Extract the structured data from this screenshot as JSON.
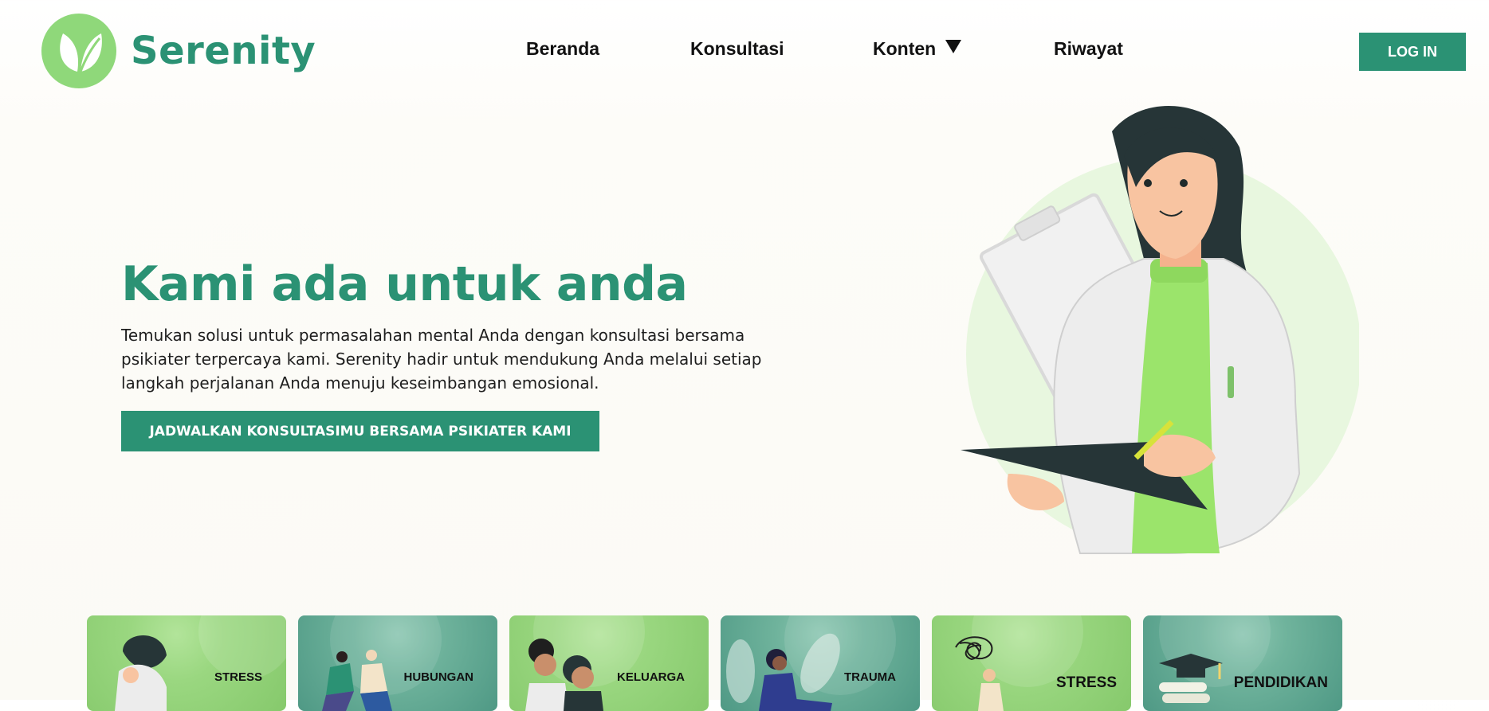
{
  "brand": {
    "name": "Serenity",
    "logo_icon": "leaf-icon"
  },
  "nav": {
    "items": [
      {
        "label": "Beranda"
      },
      {
        "label": "Konsultasi"
      },
      {
        "label": "Konten",
        "has_dropdown": true
      },
      {
        "label": "Riwayat"
      }
    ],
    "login_label": "LOG IN"
  },
  "hero": {
    "title": "Kami ada untuk anda",
    "description": "Temukan solusi untuk permasalahan mental Anda dengan konsultasi bersama psikiater terpercaya kami. Serenity hadir untuk mendukung Anda melalui setiap langkah perjalanan Anda menuju keseimbangan emosional.",
    "cta_label": "JADWALKAN KONSULTASIMU BERSAMA PSIKIATER KAMI",
    "illustration": "doctor-illustration"
  },
  "categories": [
    {
      "label": "STRESS"
    },
    {
      "label": "HUBUNGAN"
    },
    {
      "label": "KELUARGA"
    },
    {
      "label": "TRAUMA"
    },
    {
      "label": "STRESS"
    },
    {
      "label": "PENDIDIKAN"
    }
  ],
  "colors": {
    "primary": "#2b9274",
    "logo_green": "#8fd87a",
    "card_green": "#9ad780",
    "card_teal": "#6fb39c"
  }
}
